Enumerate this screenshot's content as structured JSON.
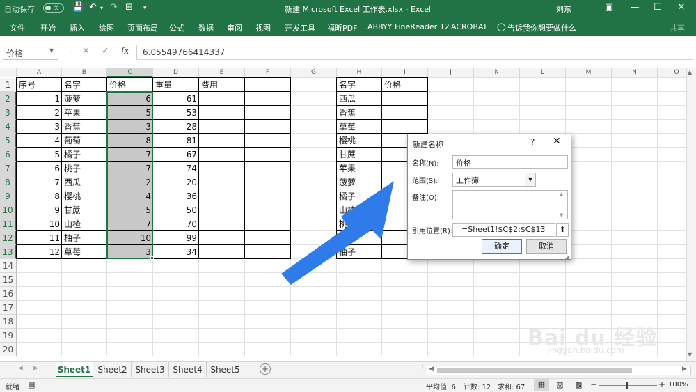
{
  "titlebar": {
    "autosave_label": "自动保存",
    "autosave_state": "关",
    "title": "新建 Microsoft Excel 工作表.xlsx  -  Excel",
    "user": "刘东"
  },
  "ribbon_tabs": [
    "文件",
    "开始",
    "插入",
    "绘图",
    "页面布局",
    "公式",
    "数据",
    "审阅",
    "视图",
    "开发工具",
    "福昕PDF",
    "ABBYY FineReader 12",
    "ACROBAT"
  ],
  "ribbon_tell_me": "告诉我你想要做什么",
  "ribbon_share": "共享",
  "formula": {
    "namebox": "价格",
    "value": "6.05549766414337"
  },
  "columns": [
    "A",
    "B",
    "C",
    "D",
    "E",
    "F",
    "G",
    "H",
    "I",
    "J",
    "K",
    "L",
    "M",
    "N",
    "O"
  ],
  "rows": [
    "1",
    "2",
    "3",
    "4",
    "5",
    "6",
    "7",
    "8",
    "9",
    "10",
    "11",
    "12",
    "13",
    "14",
    "15",
    "16",
    "17",
    "18",
    "19",
    "20"
  ],
  "table1": {
    "headers": [
      "序号",
      "名字",
      "价格",
      "重量",
      "费用"
    ],
    "rows": [
      [
        "1",
        "菠萝",
        "6",
        "61",
        ""
      ],
      [
        "2",
        "苹果",
        "5",
        "53",
        ""
      ],
      [
        "3",
        "香蕉",
        "3",
        "28",
        ""
      ],
      [
        "4",
        "葡萄",
        "8",
        "81",
        ""
      ],
      [
        "5",
        "橘子",
        "7",
        "67",
        ""
      ],
      [
        "6",
        "桃子",
        "7",
        "74",
        ""
      ],
      [
        "7",
        "西瓜",
        "2",
        "20",
        ""
      ],
      [
        "8",
        "樱桃",
        "4",
        "36",
        ""
      ],
      [
        "9",
        "甘蔗",
        "5",
        "50",
        ""
      ],
      [
        "10",
        "山楂",
        "7",
        "70",
        ""
      ],
      [
        "11",
        "柚子",
        "10",
        "99",
        ""
      ],
      [
        "12",
        "草莓",
        "3",
        "34",
        ""
      ]
    ]
  },
  "table2": {
    "headers": [
      "名字",
      "价格"
    ],
    "names": [
      "西瓜",
      "香蕉",
      "草莓",
      "樱桃",
      "甘蔗",
      "苹果",
      "菠萝",
      "橘子",
      "山楂",
      "桃子",
      "葡萄",
      "柚子"
    ]
  },
  "dialog": {
    "title": "新建名称",
    "help": "?",
    "close": "✕",
    "name_label": "名称(N):",
    "name_value": "价格",
    "scope_label": "范围(S):",
    "scope_value": "工作簿",
    "comment_label": "备注(O):",
    "ref_label": "引用位置(R):",
    "ref_value": "=Sheet1!$C$2:$C$13",
    "ok": "确定",
    "cancel": "取消"
  },
  "sheets": [
    "Sheet1",
    "Sheet2",
    "Sheet3",
    "Sheet4",
    "Sheet5"
  ],
  "status": {
    "mode": "就绪",
    "average": "平均值: 6",
    "count": "计数: 12",
    "sum": "求和: 67",
    "zoom": "100%"
  },
  "watermark": {
    "main": "Bai du 经验",
    "sub": "jingyan.baidu.com"
  },
  "colors": {
    "excel_green": "#217346",
    "arrow_blue": "#2f7bea",
    "selection_fill": "#c8c8c8"
  }
}
